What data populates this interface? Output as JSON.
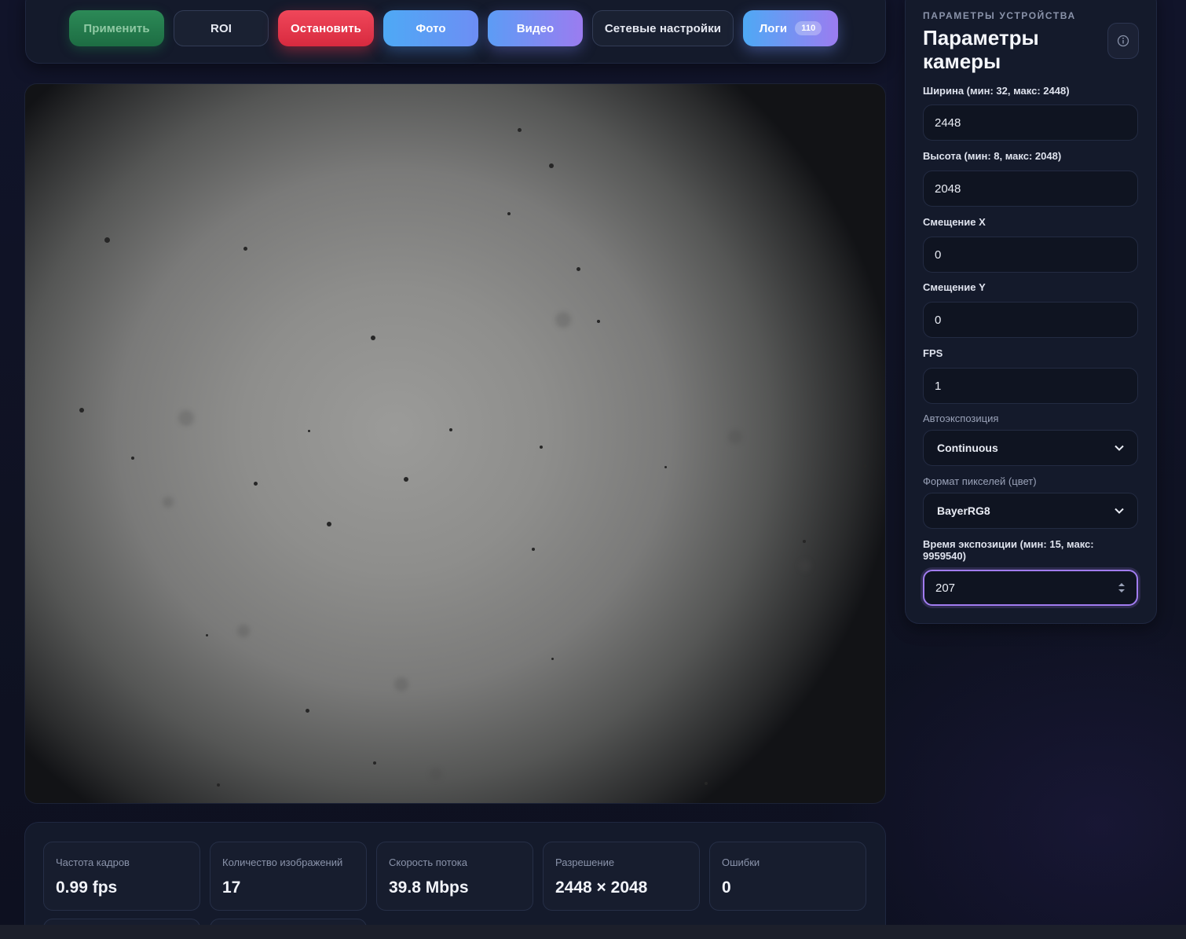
{
  "toolbar": {
    "apply": "Применить",
    "roi": "ROI",
    "stop": "Остановить",
    "photo": "Фото",
    "video": "Видео",
    "network": "Сетевые настройки",
    "logs": "Логи",
    "logs_count": "110"
  },
  "stats": [
    {
      "label": "Частота кадров",
      "value": "0.99 fps"
    },
    {
      "label": "Количество изображений",
      "value": "17"
    },
    {
      "label": "Скорость потока",
      "value": "39.8 Mbps"
    },
    {
      "label": "Разрешение",
      "value": "2448 × 2048"
    },
    {
      "label": "Ошибки",
      "value": "0"
    }
  ],
  "panel": {
    "subtitle": "ПАРАМЕТРЫ УСТРОЙСТВА",
    "title": "Параметры камеры",
    "info_icon": "info-icon",
    "fields": {
      "width_label": "Ширина (мин: 32, макс: 2448)",
      "width_value": "2448",
      "height_label": "Высота (мин: 8, макс: 2048)",
      "height_value": "2048",
      "offset_x_label": "Смещение X",
      "offset_x_value": "0",
      "offset_y_label": "Смещение Y",
      "offset_y_value": "0",
      "fps_label": "FPS",
      "fps_value": "1",
      "autoexposure_label": "Автоэкспозиция",
      "autoexposure_value": "Continuous",
      "pixel_format_label": "Формат пикселей (цвет)",
      "pixel_format_value": "BayerRG8",
      "exposure_label": "Время экспозиции (мин: 15, макс: 9959540)",
      "exposure_value": "207"
    }
  },
  "colors": {
    "apply": "#2c8a57",
    "stop": "#e8384d",
    "photo": "#4ea9f5",
    "video": "#9b7cf0",
    "focus": "#a17cf0"
  }
}
